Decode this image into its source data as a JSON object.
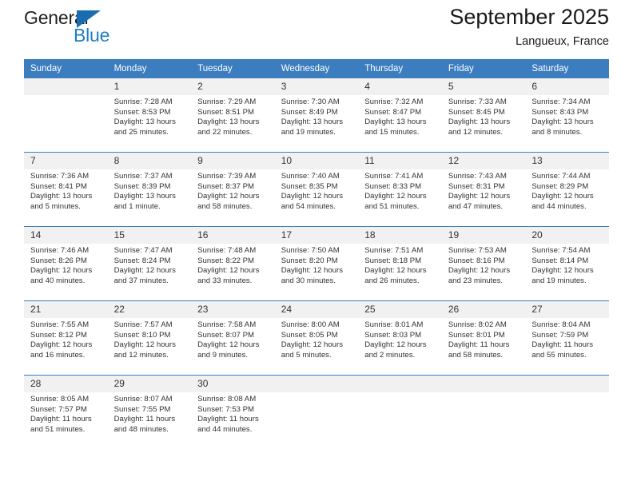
{
  "brand": {
    "name_top": "General",
    "name_bottom": "Blue",
    "accent_color": "#1e7fc4",
    "triangle_color": "#1a6cb0"
  },
  "header": {
    "month_title": "September 2025",
    "location": "Langueux, France"
  },
  "calendar": {
    "header_bg": "#3b7dbf",
    "daynum_bg": "#f1f1f1",
    "weekdays": [
      "Sunday",
      "Monday",
      "Tuesday",
      "Wednesday",
      "Thursday",
      "Friday",
      "Saturday"
    ],
    "weeks": [
      [
        {
          "day": "",
          "sunrise": "",
          "sunset": "",
          "daylight_1": "",
          "daylight_2": ""
        },
        {
          "day": "1",
          "sunrise": "Sunrise: 7:28 AM",
          "sunset": "Sunset: 8:53 PM",
          "daylight_1": "Daylight: 13 hours",
          "daylight_2": "and 25 minutes."
        },
        {
          "day": "2",
          "sunrise": "Sunrise: 7:29 AM",
          "sunset": "Sunset: 8:51 PM",
          "daylight_1": "Daylight: 13 hours",
          "daylight_2": "and 22 minutes."
        },
        {
          "day": "3",
          "sunrise": "Sunrise: 7:30 AM",
          "sunset": "Sunset: 8:49 PM",
          "daylight_1": "Daylight: 13 hours",
          "daylight_2": "and 19 minutes."
        },
        {
          "day": "4",
          "sunrise": "Sunrise: 7:32 AM",
          "sunset": "Sunset: 8:47 PM",
          "daylight_1": "Daylight: 13 hours",
          "daylight_2": "and 15 minutes."
        },
        {
          "day": "5",
          "sunrise": "Sunrise: 7:33 AM",
          "sunset": "Sunset: 8:45 PM",
          "daylight_1": "Daylight: 13 hours",
          "daylight_2": "and 12 minutes."
        },
        {
          "day": "6",
          "sunrise": "Sunrise: 7:34 AM",
          "sunset": "Sunset: 8:43 PM",
          "daylight_1": "Daylight: 13 hours",
          "daylight_2": "and 8 minutes."
        }
      ],
      [
        {
          "day": "7",
          "sunrise": "Sunrise: 7:36 AM",
          "sunset": "Sunset: 8:41 PM",
          "daylight_1": "Daylight: 13 hours",
          "daylight_2": "and 5 minutes."
        },
        {
          "day": "8",
          "sunrise": "Sunrise: 7:37 AM",
          "sunset": "Sunset: 8:39 PM",
          "daylight_1": "Daylight: 13 hours",
          "daylight_2": "and 1 minute."
        },
        {
          "day": "9",
          "sunrise": "Sunrise: 7:39 AM",
          "sunset": "Sunset: 8:37 PM",
          "daylight_1": "Daylight: 12 hours",
          "daylight_2": "and 58 minutes."
        },
        {
          "day": "10",
          "sunrise": "Sunrise: 7:40 AM",
          "sunset": "Sunset: 8:35 PM",
          "daylight_1": "Daylight: 12 hours",
          "daylight_2": "and 54 minutes."
        },
        {
          "day": "11",
          "sunrise": "Sunrise: 7:41 AM",
          "sunset": "Sunset: 8:33 PM",
          "daylight_1": "Daylight: 12 hours",
          "daylight_2": "and 51 minutes."
        },
        {
          "day": "12",
          "sunrise": "Sunrise: 7:43 AM",
          "sunset": "Sunset: 8:31 PM",
          "daylight_1": "Daylight: 12 hours",
          "daylight_2": "and 47 minutes."
        },
        {
          "day": "13",
          "sunrise": "Sunrise: 7:44 AM",
          "sunset": "Sunset: 8:29 PM",
          "daylight_1": "Daylight: 12 hours",
          "daylight_2": "and 44 minutes."
        }
      ],
      [
        {
          "day": "14",
          "sunrise": "Sunrise: 7:46 AM",
          "sunset": "Sunset: 8:26 PM",
          "daylight_1": "Daylight: 12 hours",
          "daylight_2": "and 40 minutes."
        },
        {
          "day": "15",
          "sunrise": "Sunrise: 7:47 AM",
          "sunset": "Sunset: 8:24 PM",
          "daylight_1": "Daylight: 12 hours",
          "daylight_2": "and 37 minutes."
        },
        {
          "day": "16",
          "sunrise": "Sunrise: 7:48 AM",
          "sunset": "Sunset: 8:22 PM",
          "daylight_1": "Daylight: 12 hours",
          "daylight_2": "and 33 minutes."
        },
        {
          "day": "17",
          "sunrise": "Sunrise: 7:50 AM",
          "sunset": "Sunset: 8:20 PM",
          "daylight_1": "Daylight: 12 hours",
          "daylight_2": "and 30 minutes."
        },
        {
          "day": "18",
          "sunrise": "Sunrise: 7:51 AM",
          "sunset": "Sunset: 8:18 PM",
          "daylight_1": "Daylight: 12 hours",
          "daylight_2": "and 26 minutes."
        },
        {
          "day": "19",
          "sunrise": "Sunrise: 7:53 AM",
          "sunset": "Sunset: 8:16 PM",
          "daylight_1": "Daylight: 12 hours",
          "daylight_2": "and 23 minutes."
        },
        {
          "day": "20",
          "sunrise": "Sunrise: 7:54 AM",
          "sunset": "Sunset: 8:14 PM",
          "daylight_1": "Daylight: 12 hours",
          "daylight_2": "and 19 minutes."
        }
      ],
      [
        {
          "day": "21",
          "sunrise": "Sunrise: 7:55 AM",
          "sunset": "Sunset: 8:12 PM",
          "daylight_1": "Daylight: 12 hours",
          "daylight_2": "and 16 minutes."
        },
        {
          "day": "22",
          "sunrise": "Sunrise: 7:57 AM",
          "sunset": "Sunset: 8:10 PM",
          "daylight_1": "Daylight: 12 hours",
          "daylight_2": "and 12 minutes."
        },
        {
          "day": "23",
          "sunrise": "Sunrise: 7:58 AM",
          "sunset": "Sunset: 8:07 PM",
          "daylight_1": "Daylight: 12 hours",
          "daylight_2": "and 9 minutes."
        },
        {
          "day": "24",
          "sunrise": "Sunrise: 8:00 AM",
          "sunset": "Sunset: 8:05 PM",
          "daylight_1": "Daylight: 12 hours",
          "daylight_2": "and 5 minutes."
        },
        {
          "day": "25",
          "sunrise": "Sunrise: 8:01 AM",
          "sunset": "Sunset: 8:03 PM",
          "daylight_1": "Daylight: 12 hours",
          "daylight_2": "and 2 minutes."
        },
        {
          "day": "26",
          "sunrise": "Sunrise: 8:02 AM",
          "sunset": "Sunset: 8:01 PM",
          "daylight_1": "Daylight: 11 hours",
          "daylight_2": "and 58 minutes."
        },
        {
          "day": "27",
          "sunrise": "Sunrise: 8:04 AM",
          "sunset": "Sunset: 7:59 PM",
          "daylight_1": "Daylight: 11 hours",
          "daylight_2": "and 55 minutes."
        }
      ],
      [
        {
          "day": "28",
          "sunrise": "Sunrise: 8:05 AM",
          "sunset": "Sunset: 7:57 PM",
          "daylight_1": "Daylight: 11 hours",
          "daylight_2": "and 51 minutes."
        },
        {
          "day": "29",
          "sunrise": "Sunrise: 8:07 AM",
          "sunset": "Sunset: 7:55 PM",
          "daylight_1": "Daylight: 11 hours",
          "daylight_2": "and 48 minutes."
        },
        {
          "day": "30",
          "sunrise": "Sunrise: 8:08 AM",
          "sunset": "Sunset: 7:53 PM",
          "daylight_1": "Daylight: 11 hours",
          "daylight_2": "and 44 minutes."
        },
        {
          "day": "",
          "sunrise": "",
          "sunset": "",
          "daylight_1": "",
          "daylight_2": ""
        },
        {
          "day": "",
          "sunrise": "",
          "sunset": "",
          "daylight_1": "",
          "daylight_2": ""
        },
        {
          "day": "",
          "sunrise": "",
          "sunset": "",
          "daylight_1": "",
          "daylight_2": ""
        },
        {
          "day": "",
          "sunrise": "",
          "sunset": "",
          "daylight_1": "",
          "daylight_2": ""
        }
      ]
    ]
  }
}
